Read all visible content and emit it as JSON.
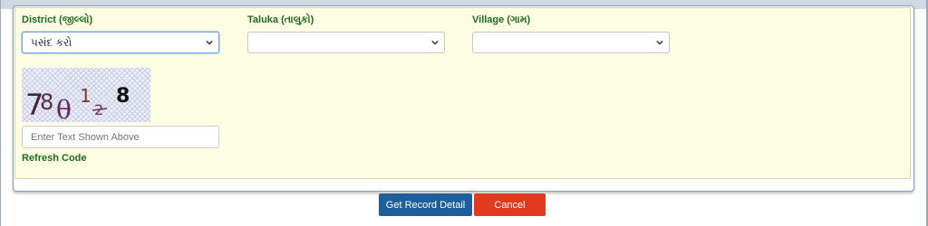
{
  "form": {
    "district_label": "District (જીલ્લો)",
    "taluka_label": "Taluka (તાલુકો)",
    "village_label": "Village (ગામ)",
    "district_value": "પસંદ કરો",
    "taluka_value": "",
    "village_value": "",
    "captcha_text": "78θ1₂8",
    "captcha_placeholder": "Enter Text Shown Above",
    "refresh_label": "Refresh Code"
  },
  "actions": {
    "submit_label": "Get Record Detail",
    "cancel_label": "Cancel"
  },
  "colors": {
    "panel_bg": "#fdfde3",
    "label_green": "#1e6b1e",
    "primary_button": "#1c5f9a",
    "cancel_button": "#e13a1f"
  }
}
